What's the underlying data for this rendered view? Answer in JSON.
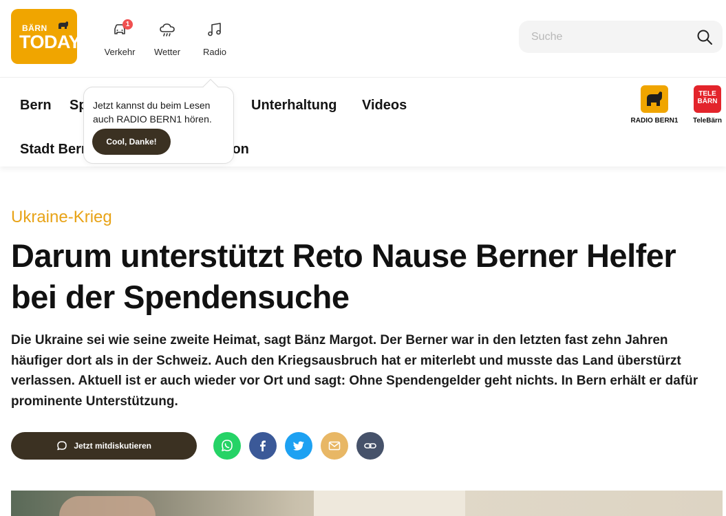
{
  "header": {
    "logo": {
      "line1": "BÄRN",
      "line2": "TODAY"
    },
    "quicknav": [
      {
        "label": "Verkehr",
        "icon": "car-icon",
        "badge": "1"
      },
      {
        "label": "Wetter",
        "icon": "cloud-rain-icon"
      },
      {
        "label": "Radio",
        "icon": "music-note-icon"
      }
    ],
    "search": {
      "placeholder": "Suche",
      "value": ""
    }
  },
  "nav": {
    "row1": [
      "Bern",
      "Sport",
      "Unterhaltung",
      "Videos"
    ],
    "row2": [
      "Stadt Bern",
      "Kanton"
    ],
    "brands": [
      {
        "label": "RADIO BERN1",
        "color": "#f0a500"
      },
      {
        "label": "TeleBärn",
        "tile_text_1": "TELE",
        "tile_text_2": "BÄRN",
        "color": "#e3242b"
      }
    ]
  },
  "tooltip": {
    "text": "Jetzt kannst du beim Lesen auch RADIO BERN1 hören.",
    "button": "Cool, Danke!"
  },
  "article": {
    "kicker": "Ukraine-Krieg",
    "headline": "Darum unterstützt Reto Nause Berner Helfer bei der Spendensuche",
    "lead": "Die Ukraine sei wie seine zweite Heimat, sagt Bänz Margot. Der Berner war in den letzten fast zehn Jahren häufiger dort als in der Schweiz. Auch den Kriegsausbruch hat er miterlebt und musste das Land überstürzt verlassen. Aktuell ist er auch wieder vor Ort und sagt: Ohne Spendengelder geht nichts. In Bern erhält er dafür prominente Unterstützung.",
    "discuss_button": "Jetzt mitdiskutieren",
    "share": [
      {
        "name": "whatsapp-icon",
        "color": "#25d366"
      },
      {
        "name": "facebook-icon",
        "color": "#3b5998"
      },
      {
        "name": "twitter-icon",
        "color": "#1da1f2"
      },
      {
        "name": "mail-icon",
        "color": "#e8b765"
      },
      {
        "name": "link-icon",
        "color": "#46526a"
      }
    ]
  },
  "colors": {
    "accent": "#f0a500",
    "kicker": "#e8a317",
    "dark_button": "#3b3122"
  }
}
